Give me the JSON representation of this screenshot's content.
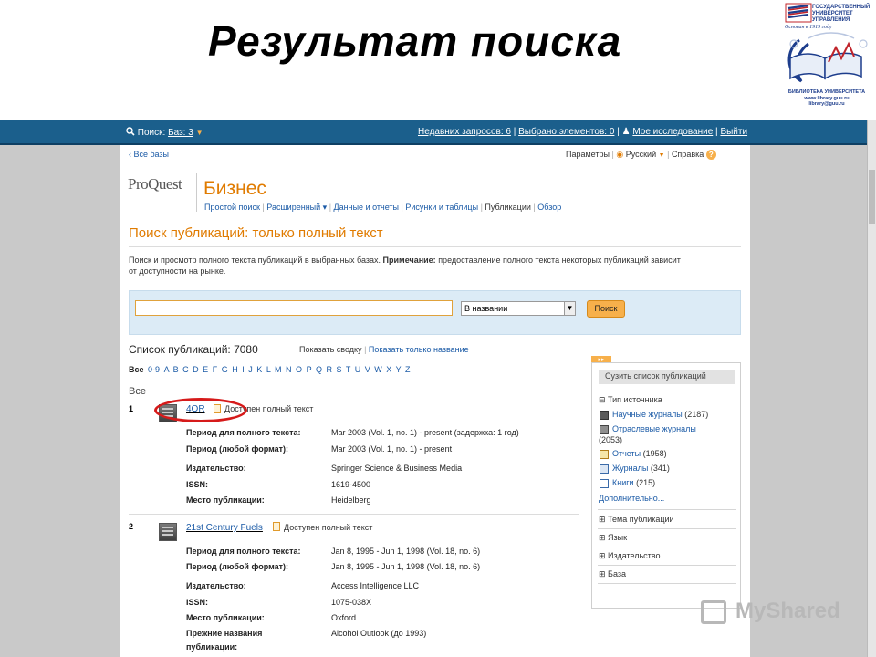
{
  "slide_title": "Результат поиска",
  "logo": {
    "university": "ГОСУДАРСТВЕННЫЙ УНИВЕРСИТЕТ УПРАВЛЕНИЯ",
    "since": "Основан в 1919 году",
    "library_lines": [
      "БИБЛИОТЕКА УНИВЕРСИТЕТА",
      "www.library.guu.ru",
      "library@guu.ru"
    ]
  },
  "topbar": {
    "search_label": "Поиск:",
    "databases": "Баз: 3",
    "recent": "Недавних запросов: 6",
    "selected": "Выбрано элементов: 0",
    "my_research": "Мое исследование",
    "logout": "Выйти",
    "separator": "|"
  },
  "nav": {
    "back": "‹ Все базы",
    "params": "Параметры",
    "language": "Русский",
    "help": "Справка"
  },
  "brand": {
    "proquest": "ProQuest",
    "product": "Бизнес"
  },
  "menu": [
    "Простой поиск",
    "Расширенный ▾",
    "Данные и отчеты",
    "Рисунки и таблицы",
    "Публикации",
    "Обзор"
  ],
  "page": {
    "heading": "Поиск публикаций: только полный текст",
    "description_1": "Поиск и просмотр полного текста публикаций в выбранных базах.",
    "note_label": "Примечание:",
    "description_2": "предоставление полного текста некоторых публикаций зависит",
    "description_3": "от доступности на рынке."
  },
  "search": {
    "value": "",
    "field_option": "В названии",
    "button": "Поиск"
  },
  "list": {
    "title": "Список публикаций: 7080",
    "show_summary": "Показать сводку",
    "show_titles": "Показать только название",
    "alphabet": [
      "Все",
      "0-9",
      "A",
      "B",
      "C",
      "D",
      "E",
      "F",
      "G",
      "H",
      "I",
      "J",
      "K",
      "L",
      "M",
      "N",
      "O",
      "P",
      "Q",
      "R",
      "S",
      "T",
      "U",
      "V",
      "W",
      "X",
      "Y",
      "Z"
    ],
    "current_letter": "Все",
    "full_text_label": "Доступен полный текст",
    "items": [
      {
        "num": "1",
        "title": "4OR",
        "fields": [
          [
            "Период для полного текста:",
            "Mar 2003 (Vol. 1, no. 1) - present (задержка: 1 год)"
          ],
          [
            "Период (любой формат):",
            "Mar 2003 (Vol. 1, no. 1) - present"
          ],
          [
            "Издательство:",
            "Springer Science & Business Media"
          ],
          [
            "ISSN:",
            "1619-4500"
          ],
          [
            "Место публикации:",
            "Heidelberg"
          ]
        ]
      },
      {
        "num": "2",
        "title": "21st Century Fuels",
        "fields": [
          [
            "Период для полного текста:",
            "Jan 8, 1995 - Jun 1, 1998 (Vol. 18, no. 6)"
          ],
          [
            "Период (любой формат):",
            "Jan 8, 1995 - Jun 1, 1998 (Vol. 18, no. 6)"
          ],
          [
            "Издательство:",
            "Access Intelligence LLC"
          ],
          [
            "ISSN:",
            "1075-038X"
          ],
          [
            "Место публикации:",
            "Oxford"
          ],
          [
            "Прежние названия",
            "Alcohol Outlook (до 1993)"
          ],
          [
            "публикации:",
            ""
          ]
        ]
      }
    ]
  },
  "sidebar": {
    "tab": "▸▸",
    "header": "Сузить список публикаций",
    "source_type": "⊟ Тип источника",
    "sources": [
      {
        "label": "Научные журналы",
        "count": "(2187)"
      },
      {
        "label": "Отраслевые журналы",
        "count": "(2053)"
      },
      {
        "label": "Отчеты",
        "count": "(1958)"
      },
      {
        "label": "Журналы",
        "count": "(341)"
      },
      {
        "label": "Книги",
        "count": "(215)"
      }
    ],
    "more": "Дополнительно...",
    "sections": [
      "⊞ Тема публикации",
      "⊞ Язык",
      "⊞ Издательство",
      "⊞ База"
    ]
  },
  "watermark": "MyShared"
}
